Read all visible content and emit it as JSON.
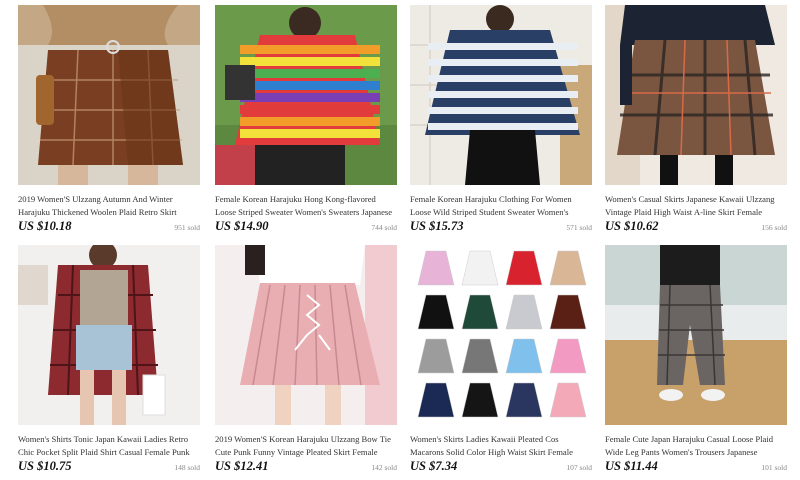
{
  "products": [
    {
      "title": "2019 Women'S Ulzzang Autumn And Winter Harajuku Thickened Woolen Plaid Retro Skirt Female Cute...",
      "price": "US $10.18",
      "sold": "951 sold",
      "image": "brown-plaid-wrap-skirt"
    },
    {
      "title": "Female Korean Harajuku Hong Kong-flavored Loose Striped Sweater Women's Sweaters Japanese Kawaii...",
      "price": "US $14.90",
      "sold": "744 sold",
      "image": "rainbow-striped-sweater"
    },
    {
      "title": "Female Korean Harajuku Clothing For Women Loose Wild Striped Student Sweater Women's Sweaters...",
      "price": "US $15.73",
      "sold": "571 sold",
      "image": "navy-striped-sweater"
    },
    {
      "title": "Women's Casual Skirts Japanese Kawaii Ulzzang Vintage Plaid High Waist A-line Skirt Female Korea...",
      "price": "US $10.62",
      "sold": "156 sold",
      "image": "plaid-a-line-skirt"
    },
    {
      "title": "Women's Shirts Tonic Japan Kawaii Ladies Retro Chic Pocket Split Plaid Shirt Casual Female Punk Harajuku...",
      "price": "US $10.75",
      "sold": "148 sold",
      "image": "red-plaid-shirt"
    },
    {
      "title": "2019 Women'S Korean Harajuku Ulzzang Bow Tie Cute Punk Funny Vintage Pleated Skirt Female Cute...",
      "price": "US $12.41",
      "sold": "142 sold",
      "image": "pink-pleated-skirt"
    },
    {
      "title": "Women's Skirts Ladies Kawaii Pleated Cos Macarons Solid Color High Waist Skirt Female Korean Harajuku...",
      "price": "US $7.34",
      "sold": "107 sold",
      "image": "pleated-skirt-colors"
    },
    {
      "title": "Female Cute Japan Harajuku Casual Loose Plaid Wide Leg Pants Women's Trousers Japanese Kawaii...",
      "price": "US $11.44",
      "sold": "101 sold",
      "image": "plaid-wide-leg-pants"
    }
  ],
  "colors": {
    "price": "#111111",
    "sold": "#888888",
    "title": "#333333"
  }
}
